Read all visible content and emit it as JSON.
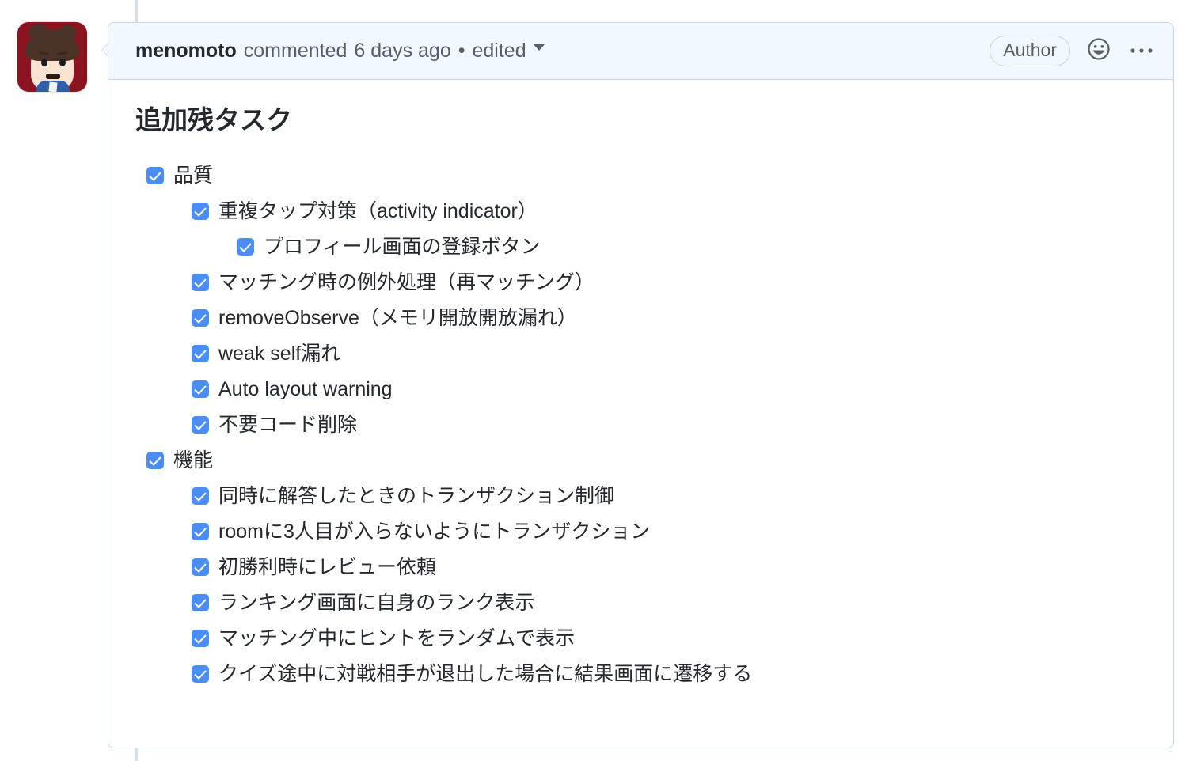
{
  "comment": {
    "author": "menomoto",
    "commented_text": "commented",
    "time_ago": "6 days ago",
    "separator_dot": "•",
    "edited_label": "edited",
    "author_badge": "Author",
    "reaction_icon": "smiley-icon",
    "more_icon": "kebab-menu-icon",
    "avatar_alt": "menomoto avatar",
    "colors": {
      "header_bg": "#f1f8ff",
      "border": "#c8d6e5",
      "checkbox_blue": "#4a8ef5",
      "text": "#24292f",
      "muted_text": "#57606a",
      "timeline_rail": "#d8dee4"
    }
  },
  "body": {
    "title": "追加残タスク",
    "tasks": [
      {
        "level": 1,
        "checked": true,
        "label": "品質"
      },
      {
        "level": 2,
        "checked": true,
        "label": "重複タップ対策（activity indicator）"
      },
      {
        "level": 3,
        "checked": true,
        "label": "プロフィール画面の登録ボタン"
      },
      {
        "level": 2,
        "checked": true,
        "label": "マッチング時の例外処理（再マッチング）"
      },
      {
        "level": 2,
        "checked": true,
        "label": "removeObserve（メモリ開放開放漏れ）"
      },
      {
        "level": 2,
        "checked": true,
        "label": "weak self漏れ"
      },
      {
        "level": 2,
        "checked": true,
        "label": "Auto layout warning"
      },
      {
        "level": 2,
        "checked": true,
        "label": "不要コード削除"
      },
      {
        "level": 1,
        "checked": true,
        "label": "機能"
      },
      {
        "level": 2,
        "checked": true,
        "label": "同時に解答したときのトランザクション制御"
      },
      {
        "level": 2,
        "checked": true,
        "label": "roomに3人目が入らないようにトランザクション"
      },
      {
        "level": 2,
        "checked": true,
        "label": "初勝利時にレビュー依頼"
      },
      {
        "level": 2,
        "checked": true,
        "label": "ランキング画面に自身のランク表示"
      },
      {
        "level": 2,
        "checked": true,
        "label": "マッチング中にヒントをランダムで表示"
      },
      {
        "level": 2,
        "checked": true,
        "label": "クイズ途中に対戦相手が退出した場合に結果画面に遷移する"
      }
    ]
  }
}
